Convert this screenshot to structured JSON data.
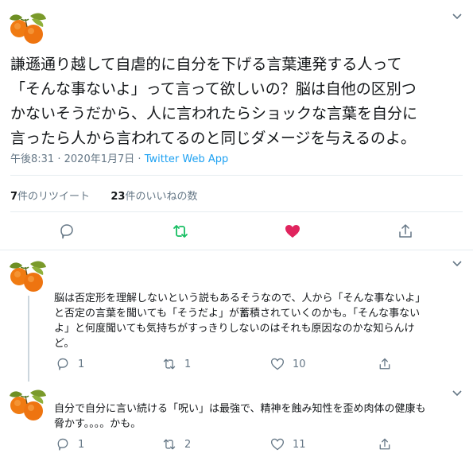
{
  "main_tweet": {
    "text": "謙遜通り越して自虐的に自分を下げる言葉連発する人って\n「そんな事ないよ」って言って欲しいの？脳は自他の区別つ\nかないそうだから、人に言われたらショックな言葉を自分に\n言ったら人から言われてるのと同じダメージを与えるのよ。",
    "time": "午後8:31",
    "date": "2020年1月7日",
    "separator": "·",
    "source": "Twitter Web App",
    "retweet_count": "7",
    "retweet_label": "件のリツイート",
    "like_count": "23",
    "like_label": "件のいいねの数"
  },
  "replies": [
    {
      "text": "脳は否定形を理解しないという説もあるそうなので、人から「そんな事ないよ」\nと否定の言葉を聞いても「そうだよ」が蓄積されていくのかも。「そんな事ない\nよ」と何度聞いても気持ちがすっきりしないのはそれも原因なのかな知らんけ\nど。",
      "reply_count": "1",
      "retweet_count": "1",
      "like_count": "10"
    },
    {
      "text": "自分で自分に言い続ける「呪い」は最強で、精神を蝕み知性を歪め肉体の健康も\n脅かす。。。。かも。",
      "reply_count": "1",
      "retweet_count": "2",
      "like_count": "11"
    }
  ],
  "colors": {
    "text": "#14171a",
    "muted": "#657786",
    "link": "#1da1f2",
    "retweet_green": "#17bf63",
    "like_red": "#e0245e",
    "divider": "#e6ecf0"
  },
  "icons": [
    "avatar-orange-icon",
    "chevron-down-icon",
    "reply-icon",
    "retweet-icon",
    "like-heart-icon",
    "share-icon"
  ]
}
